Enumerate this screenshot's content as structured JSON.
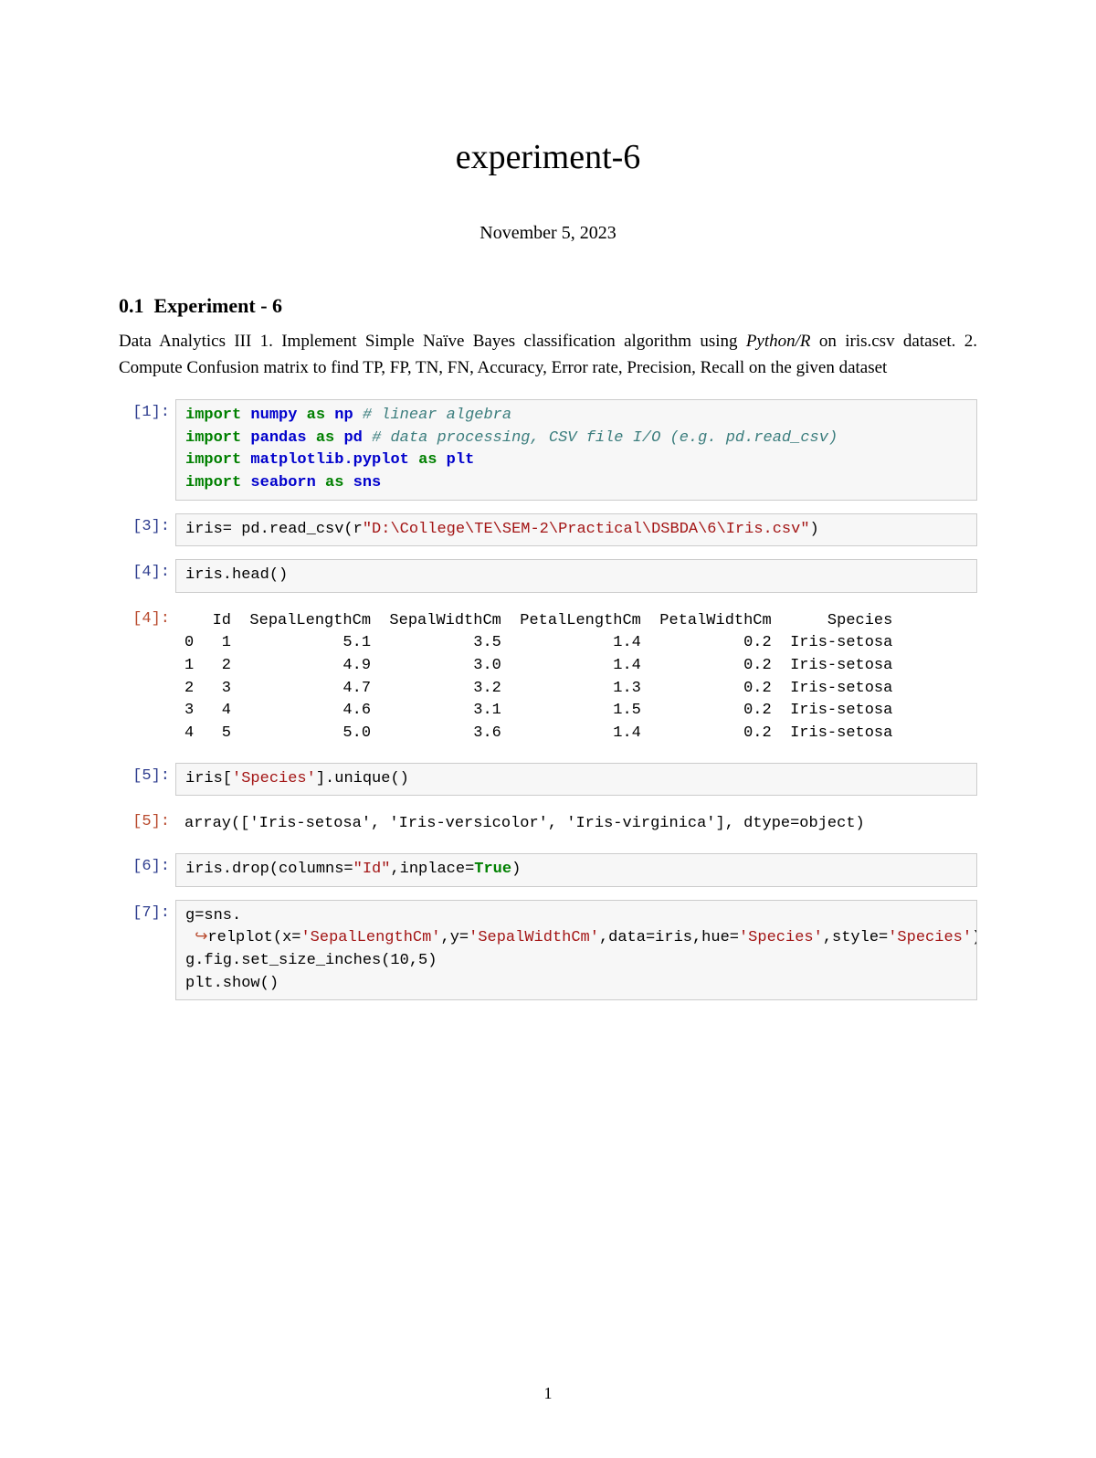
{
  "title": "experiment-6",
  "date": "November 5, 2023",
  "section_number": "0.1",
  "section_title": "Experiment - 6",
  "description_prefix": "Data Analytics III 1. Implement Simple Naïve Bayes classification algorithm using ",
  "description_italic": "Python/R",
  "description_rest": " on iris.csv dataset. 2. Compute Confusion matrix to find TP, FP, TN, FN, Accuracy, Error rate, Precision, Recall on the given dataset",
  "cells": {
    "c1_prompt": "[1]:",
    "c1_l1_import": "import",
    "c1_l1_mod": "numpy",
    "c1_l1_as": "as",
    "c1_l1_alias": "np",
    "c1_l1_cm": "# linear algebra",
    "c1_l2_import": "import",
    "c1_l2_mod": "pandas",
    "c1_l2_as": "as",
    "c1_l2_alias": "pd",
    "c1_l2_cm": "# data processing, CSV file I/O (e.g. pd.read_csv)",
    "c1_l3_import": "import",
    "c1_l3_mod": "matplotlib.pyplot",
    "c1_l3_as": "as",
    "c1_l3_alias": "plt",
    "c1_l4_import": "import",
    "c1_l4_mod": "seaborn",
    "c1_l4_as": "as",
    "c1_l4_alias": "sns",
    "c3_prompt": "[3]:",
    "c3_pre": "iris= pd.read_csv(",
    "c3_r": "r",
    "c3_str": "\"D:\\College\\TE\\SEM-2\\Practical\\DSBDA\\6\\Iris.csv\"",
    "c3_post": ")",
    "c4_prompt": "[4]:",
    "c4_code": "iris.head()",
    "c4_out_prompt": "[4]:",
    "c4_header": "   Id  SepalLengthCm  SepalWidthCm  PetalLengthCm  PetalWidthCm      Species",
    "c4_r0": "0   1            5.1           3.5            1.4           0.2  Iris-setosa",
    "c4_r1": "1   2            4.9           3.0            1.4           0.2  Iris-setosa",
    "c4_r2": "2   3            4.7           3.2            1.3           0.2  Iris-setosa",
    "c4_r3": "3   4            4.6           3.1            1.5           0.2  Iris-setosa",
    "c4_r4": "4   5            5.0           3.6            1.4           0.2  Iris-setosa",
    "c5_prompt": "[5]:",
    "c5_pre": "iris[",
    "c5_str": "'Species'",
    "c5_post": "].unique()",
    "c5_out_prompt": "[5]:",
    "c5_out": "array(['Iris-setosa', 'Iris-versicolor', 'Iris-virginica'], dtype=object)",
    "c6_prompt": "[6]:",
    "c6_pre": "iris.drop(columns=",
    "c6_str": "\"Id\"",
    "c6_mid": ",inplace=",
    "c6_true": "True",
    "c6_post": ")",
    "c7_prompt": "[7]:",
    "c7_l1": "g=sns.",
    "c7_wrap": "↪",
    "c7_l2_pre": "relplot(x=",
    "c7_l2_s1": "'SepalLengthCm'",
    "c7_l2_m1": ",y=",
    "c7_l2_s2": "'SepalWidthCm'",
    "c7_l2_m2": ",data=iris,hue=",
    "c7_l2_s3": "'Species'",
    "c7_l2_m3": ",style=",
    "c7_l2_s4": "'Species'",
    "c7_l2_post": ")",
    "c7_l3": "g.fig.set_size_inches(10,5)",
    "c7_l4": "plt.show()"
  },
  "page_number": "1"
}
